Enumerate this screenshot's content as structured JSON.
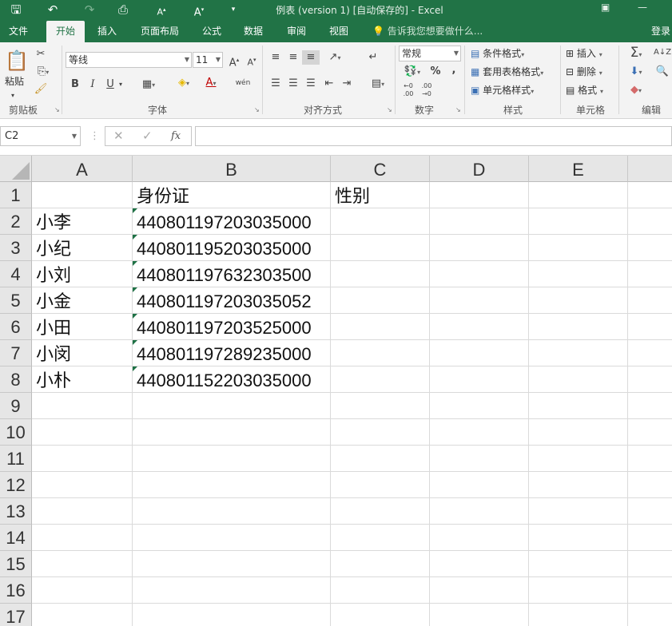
{
  "app": {
    "title": "例表 (version 1) [自动保存的] - Excel",
    "login_label": "登录",
    "tell_me": "告诉我您想要做什么...",
    "accent_color": "#217346"
  },
  "tabs": [
    {
      "label": "文件"
    },
    {
      "label": "开始",
      "active": true
    },
    {
      "label": "插入"
    },
    {
      "label": "页面布局"
    },
    {
      "label": "公式"
    },
    {
      "label": "数据"
    },
    {
      "label": "审阅"
    },
    {
      "label": "视图"
    }
  ],
  "ribbon": {
    "clipboard": {
      "paste_label": "粘贴",
      "group_label": "剪贴板"
    },
    "font": {
      "name": "等线",
      "size": "11",
      "group_label": "字体",
      "bold": "B",
      "italic": "I",
      "underline": "U",
      "phonetic": "wén"
    },
    "alignment": {
      "group_label": "对齐方式"
    },
    "number": {
      "format": "常规",
      "percent": "%",
      "comma": ",",
      "group_label": "数字"
    },
    "styles": {
      "conditional": "条件格式",
      "table_format": "套用表格格式",
      "cell_styles": "单元格样式",
      "group_label": "样式"
    },
    "cells": {
      "insert": "插入",
      "delete": "删除",
      "format": "格式",
      "group_label": "单元格"
    },
    "editing": {
      "group_label": "编辑"
    }
  },
  "formula_bar": {
    "name_box": "C2",
    "fx_label": "fx",
    "formula": ""
  },
  "sheet": {
    "columns": [
      "A",
      "B",
      "C",
      "D",
      "E"
    ],
    "row_numbers": [
      "1",
      "2",
      "3",
      "4",
      "5",
      "6",
      "7",
      "8",
      "9",
      "10",
      "11",
      "12",
      "13",
      "14",
      "15",
      "16",
      "17"
    ],
    "header_row": {
      "A": "",
      "B": "身份证",
      "C": "性别"
    },
    "rows": [
      {
        "name": "小李",
        "id": "440801197203035000",
        "gender": ""
      },
      {
        "name": "小纪",
        "id": "440801195203035000",
        "gender": ""
      },
      {
        "name": "小刘",
        "id": "440801197632303500",
        "gender": ""
      },
      {
        "name": "小金",
        "id": "440801197203035052",
        "gender": ""
      },
      {
        "name": "小田",
        "id": "440801197203525000",
        "gender": ""
      },
      {
        "name": "小闵",
        "id": "440801197289235000",
        "gender": ""
      },
      {
        "name": "小朴",
        "id": "440801152203035000",
        "gender": ""
      }
    ]
  }
}
